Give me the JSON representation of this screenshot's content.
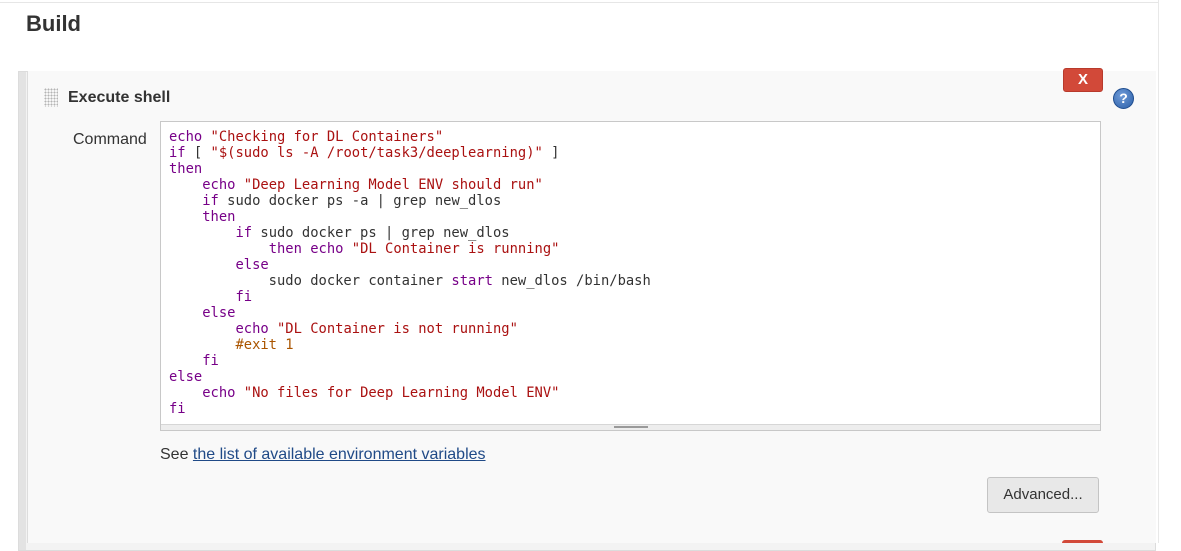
{
  "section": {
    "title": "Build"
  },
  "step": {
    "title": "Execute shell",
    "delete_label": "X",
    "help_label": "?",
    "command_label": "Command",
    "code_lines": [
      [
        {
          "t": "k",
          "v": "echo"
        },
        {
          "t": "p",
          "v": " "
        },
        {
          "t": "s",
          "v": "\"Checking for DL Containers\""
        }
      ],
      [
        {
          "t": "k",
          "v": "if"
        },
        {
          "t": "p",
          "v": " [ "
        },
        {
          "t": "s",
          "v": "\"$(sudo ls -A /root/task3/deeplearning)\""
        },
        {
          "t": "p",
          "v": " ]"
        }
      ],
      [
        {
          "t": "k",
          "v": "then"
        }
      ],
      [
        {
          "t": "p",
          "v": "    "
        },
        {
          "t": "k",
          "v": "echo"
        },
        {
          "t": "p",
          "v": " "
        },
        {
          "t": "s",
          "v": "\"Deep Learning Model ENV should run\""
        }
      ],
      [
        {
          "t": "p",
          "v": "    "
        },
        {
          "t": "k",
          "v": "if"
        },
        {
          "t": "p",
          "v": " sudo docker ps -a | grep new_dlos"
        }
      ],
      [
        {
          "t": "p",
          "v": "    "
        },
        {
          "t": "k",
          "v": "then"
        }
      ],
      [
        {
          "t": "p",
          "v": "        "
        },
        {
          "t": "k",
          "v": "if"
        },
        {
          "t": "p",
          "v": " sudo docker ps | grep new_dlos"
        }
      ],
      [
        {
          "t": "p",
          "v": "            "
        },
        {
          "t": "k",
          "v": "then"
        },
        {
          "t": "p",
          "v": " "
        },
        {
          "t": "k",
          "v": "echo"
        },
        {
          "t": "p",
          "v": " "
        },
        {
          "t": "s",
          "v": "\"DL Container is running\""
        }
      ],
      [
        {
          "t": "p",
          "v": "        "
        },
        {
          "t": "k",
          "v": "else"
        }
      ],
      [
        {
          "t": "p",
          "v": "            sudo docker container "
        },
        {
          "t": "k",
          "v": "start"
        },
        {
          "t": "p",
          "v": " new_dlos /bin/bash"
        }
      ],
      [
        {
          "t": "p",
          "v": "        "
        },
        {
          "t": "k",
          "v": "fi"
        }
      ],
      [
        {
          "t": "p",
          "v": "    "
        },
        {
          "t": "k",
          "v": "else"
        }
      ],
      [
        {
          "t": "p",
          "v": "        "
        },
        {
          "t": "k",
          "v": "echo"
        },
        {
          "t": "p",
          "v": " "
        },
        {
          "t": "s",
          "v": "\"DL Container is not running\""
        }
      ],
      [
        {
          "t": "p",
          "v": "        "
        },
        {
          "t": "c",
          "v": "#exit 1"
        }
      ],
      [
        {
          "t": "p",
          "v": "    "
        },
        {
          "t": "k",
          "v": "fi"
        }
      ],
      [
        {
          "t": "k",
          "v": "else"
        }
      ],
      [
        {
          "t": "p",
          "v": "    "
        },
        {
          "t": "k",
          "v": "echo"
        },
        {
          "t": "p",
          "v": " "
        },
        {
          "t": "s",
          "v": "\"No files for Deep Learning Model ENV\""
        }
      ],
      [
        {
          "t": "k",
          "v": "fi"
        }
      ]
    ],
    "env_prefix": "See ",
    "env_link": "the list of available environment variables",
    "advanced_label": "Advanced..."
  },
  "colors": {
    "keyword": "#770088",
    "string": "#aa1111",
    "comment": "#aa5500",
    "delete_button": "#d24939",
    "link": "#204a87"
  }
}
